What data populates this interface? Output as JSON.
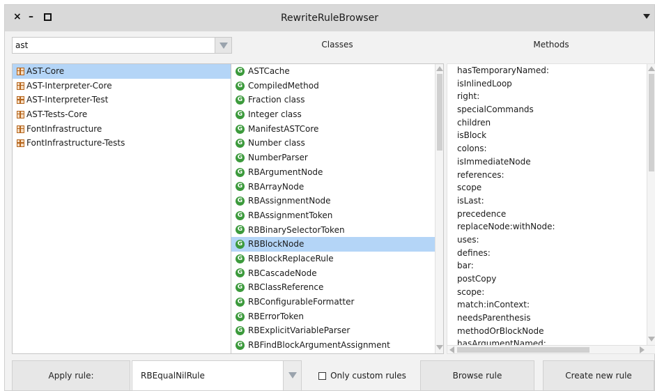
{
  "window": {
    "title": "RewriteRuleBrowser"
  },
  "search": {
    "value": "ast"
  },
  "headers": {
    "classes": "Classes",
    "methods": "Methods"
  },
  "packages": [
    "AST-Core",
    "AST-Interpreter-Core",
    "AST-Interpreter-Test",
    "AST-Tests-Core",
    "FontInfrastructure",
    "FontInfrastructure-Tests"
  ],
  "packages_selected": 0,
  "classes": [
    "ASTCache",
    "CompiledMethod",
    "Fraction class",
    "Integer class",
    "ManifestASTCore",
    "Number class",
    "NumberParser",
    "RBArgumentNode",
    "RBArrayNode",
    "RBAssignmentNode",
    "RBAssignmentToken",
    "RBBinarySelectorToken",
    "RBBlockNode",
    "RBBlockReplaceRule",
    "RBCascadeNode",
    "RBClassReference",
    "RBConfigurableFormatter",
    "RBErrorToken",
    "RBExplicitVariableParser",
    "RBFindBlockArgumentAssignment"
  ],
  "classes_selected": 12,
  "class_icon_glyph": "G",
  "methods": [
    "hasTemporaryNamed:",
    "isInlinedLoop",
    "right:",
    "specialCommands",
    "children",
    "isBlock",
    "colons:",
    "isImmediateNode",
    "references:",
    "scope",
    "isLast:",
    "precedence",
    "replaceNode:withNode:",
    "uses:",
    "defines:",
    "bar:",
    "postCopy",
    "scope:",
    "match:inContext:",
    "needsParenthesis",
    "methodOrBlockNode",
    "hasArgumentNamed:"
  ],
  "bottom": {
    "apply_label": "Apply rule:",
    "rule_value": "RBEqualNilRule",
    "only_custom_label": "Only custom rules",
    "browse_label": "Browse rule",
    "create_label": "Create new rule"
  },
  "colors": {
    "selection": "#b4d5f7",
    "package_icon": "#b5651d",
    "class_icon": "#3c9a3c",
    "titlebar": "#d9d9d9"
  },
  "icons": {
    "close": "close-icon",
    "minimize": "minimize-icon",
    "maximize": "maximize-icon",
    "package": "package-icon",
    "class": "class-icon"
  }
}
